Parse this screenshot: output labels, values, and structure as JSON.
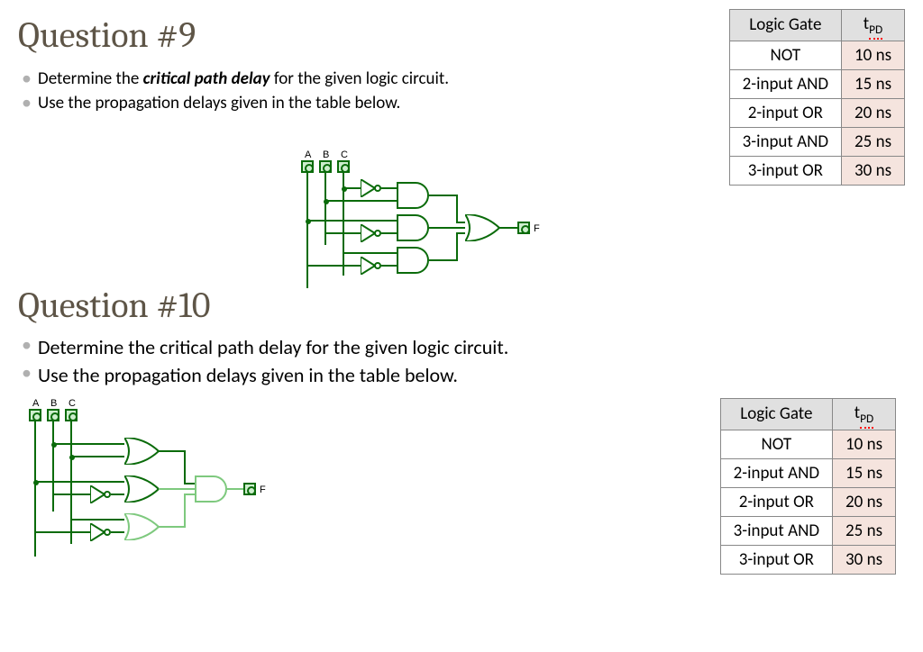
{
  "q9": {
    "title": "Question #9",
    "bullet1_pre": "Determine the ",
    "bullet1_em": "critical path delay",
    "bullet1_post": " for the given logic circuit.",
    "bullet2": "Use the propagation delays given in the table below."
  },
  "q10": {
    "title": "Question #10",
    "bullet1": "Determine the critical path delay for the given logic circuit.",
    "bullet2": "Use the propagation delays given in the table below."
  },
  "table": {
    "header_gate": "Logic Gate",
    "header_tpd_t": "t",
    "header_tpd_sub": "PD",
    "rows": [
      {
        "gate": "NOT",
        "tpd": "10 ns"
      },
      {
        "gate": "2-input AND",
        "tpd": "15 ns"
      },
      {
        "gate": "2-input OR",
        "tpd": "20 ns"
      },
      {
        "gate": "3-input AND",
        "tpd": "25 ns"
      },
      {
        "gate": "3-input OR",
        "tpd": "30 ns"
      }
    ]
  },
  "circuit": {
    "input_labels": [
      "A",
      "B",
      "C"
    ],
    "output_label": "F"
  }
}
